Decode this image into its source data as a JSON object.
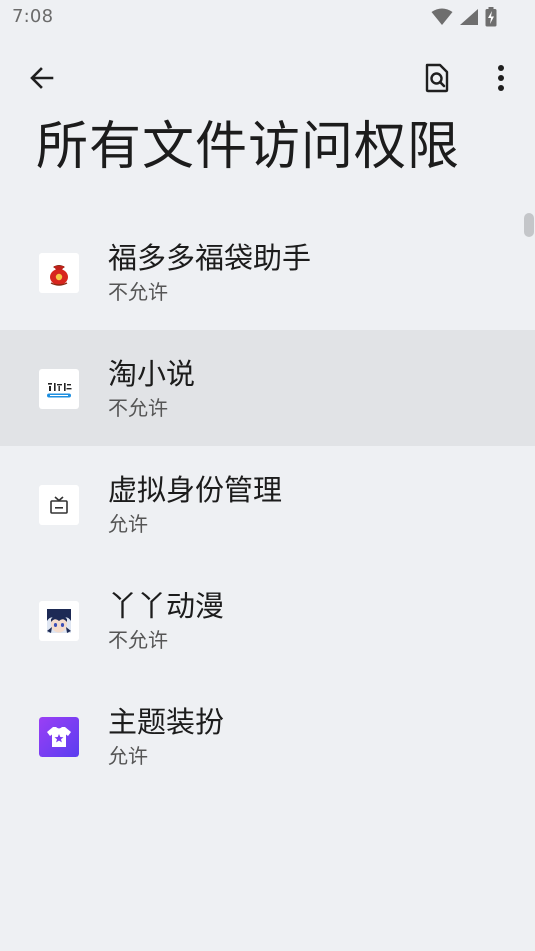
{
  "status_bar": {
    "time": "7:08",
    "icons": [
      "wifi-icon",
      "cellular-signal-icon",
      "battery-charging-icon"
    ]
  },
  "toolbar": {
    "back_icon": "arrow-left-icon",
    "search_icon": "document-search-icon",
    "more_icon": "more-vertical-icon"
  },
  "page": {
    "title": "所有文件访问权限"
  },
  "apps": [
    {
      "name": "福多多福袋助手",
      "status": "不允许",
      "icon": "lucky-bag-app-icon"
    },
    {
      "name": "淘小说",
      "status": "不允许",
      "icon": "taoxiaoshuo-app-icon"
    },
    {
      "name": "虚拟身份管理",
      "status": "允许",
      "icon": "tv-app-icon"
    },
    {
      "name": "丫丫动漫",
      "status": "不允许",
      "icon": "anime-character-app-icon"
    },
    {
      "name": "主题装扮",
      "status": "允许",
      "icon": "theme-shirt-app-icon"
    }
  ],
  "colors": {
    "background": "#eef0f3",
    "highlight_row": "#e1e3e6",
    "theme_app_purple": "#7b3ff2"
  }
}
